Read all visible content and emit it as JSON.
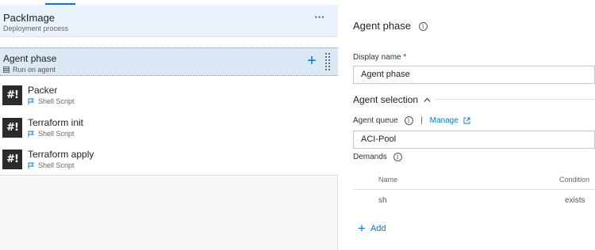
{
  "pipeline": {
    "title": "PackImage",
    "subtitle": "Deployment process",
    "more_label": "···"
  },
  "phase": {
    "title": "Agent phase",
    "subtitle": "Run on agent",
    "add_label": "+"
  },
  "tasks": [
    {
      "icon_text": "#!",
      "name": "Packer",
      "type": "Shell Script"
    },
    {
      "icon_text": "#!",
      "name": "Terraform init",
      "type": "Shell Script"
    },
    {
      "icon_text": "#!",
      "name": "Terraform apply",
      "type": "Shell Script"
    }
  ],
  "details": {
    "title": "Agent phase",
    "display_name_label": "Display name",
    "required_mark": "*",
    "display_name_value": "Agent phase",
    "agent_selection_title": "Agent selection",
    "agent_queue_label": "Agent queue",
    "separator": "|",
    "manage_label": "Manage",
    "agent_queue_value": "ACI-Pool",
    "demands_label": "Demands",
    "demands_columns": [
      "Name",
      "Condition"
    ],
    "demands_rows": [
      {
        "name": "sh",
        "condition": "exists"
      }
    ],
    "add_label": "Add"
  },
  "colors": {
    "accent": "#0078d4",
    "selected_row": "#dbe8f6",
    "header_bg": "#eaf2fb"
  }
}
